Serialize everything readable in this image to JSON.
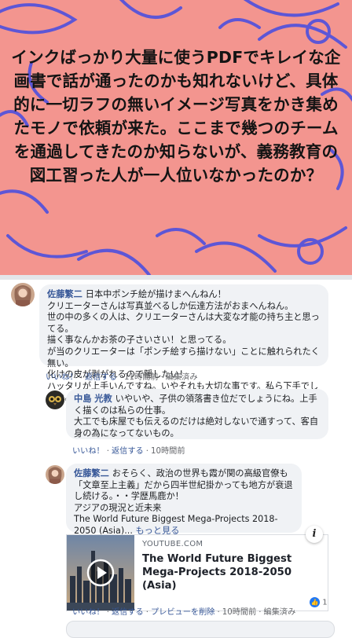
{
  "post": {
    "text": "インクばっかり大量に使うPDFでキレイな企画書で話が通ったのかも知れないけど、具体的に一切ラフの無いイメージ写真をかき集めたモノで依頼が来た。ここまで幾つのチームを通過してきたのか知らないが、義務教育の図工習った人が一人位いなかったのか？"
  },
  "comments": [
    {
      "author": "佐藤繁二",
      "lines": [
        "日本中ポンチ絵が描けまへんねん！",
        "クリエーターさんは写真並べるしか伝達方法がおまへんねん。",
        "世の中の多くの人は、クリエーターさんは大変な才能の持ち主と思ってる。",
        "描く事なんかお茶の子さいさい！と思ってる。",
        "が当のクリエーターは「ポンチ絵すら描けない」ことに触れられたく無い。",
        "化けの皮が剥がれるので隠したい！",
        "ハッタリが上手いんですね。いやそれも大切な事です。私ら下手でしたね。"
      ],
      "actions": {
        "like": "いいね！",
        "reply": "返信する",
        "time": "11時間前",
        "edited": "編集済み"
      }
    },
    {
      "author": "中島 光教",
      "lines": [
        "いやいや、子供の領落書き位だでしょうにね。上手く描くのは私らの仕事。",
        "大工でも床屋でも伝えるのだけは絶対しないで通すって、客自身の為になってないもの。"
      ],
      "actions": {
        "like": "いいね！",
        "reply": "返信する",
        "time": "10時間前"
      }
    },
    {
      "author": "佐藤繁二",
      "lines": [
        "おそらく、政治の世界も霞が関の高級官僚も「文章至上主義」だから四半世紀掛かっても地方が衰退し続ける。・・学歴馬鹿か！",
        "アジアの現況と近未来",
        "The World Future Biggest Mega-Projects 2018-2050 (Asia)..."
      ],
      "more": "もっと見る",
      "actions": {
        "like": "いいね！",
        "reply": "返信する",
        "remove_preview": "プレビューを削除",
        "time": "10時間前",
        "edited": "編集済み"
      },
      "link_preview": {
        "domain": "YOUTUBE.COM",
        "title": "The World Future Biggest Mega-Projects 2018-2050 (Asia)"
      },
      "reaction_count": "1"
    }
  ],
  "icons": {
    "info": "i",
    "like": "👍",
    "play": "play-icon"
  },
  "colors": {
    "poster_bg": "#f3958f",
    "poster_lines": "#5a58d8",
    "link_blue": "#385898",
    "bubble_bg": "#f0f2f5",
    "like_blue": "#2078f4"
  }
}
